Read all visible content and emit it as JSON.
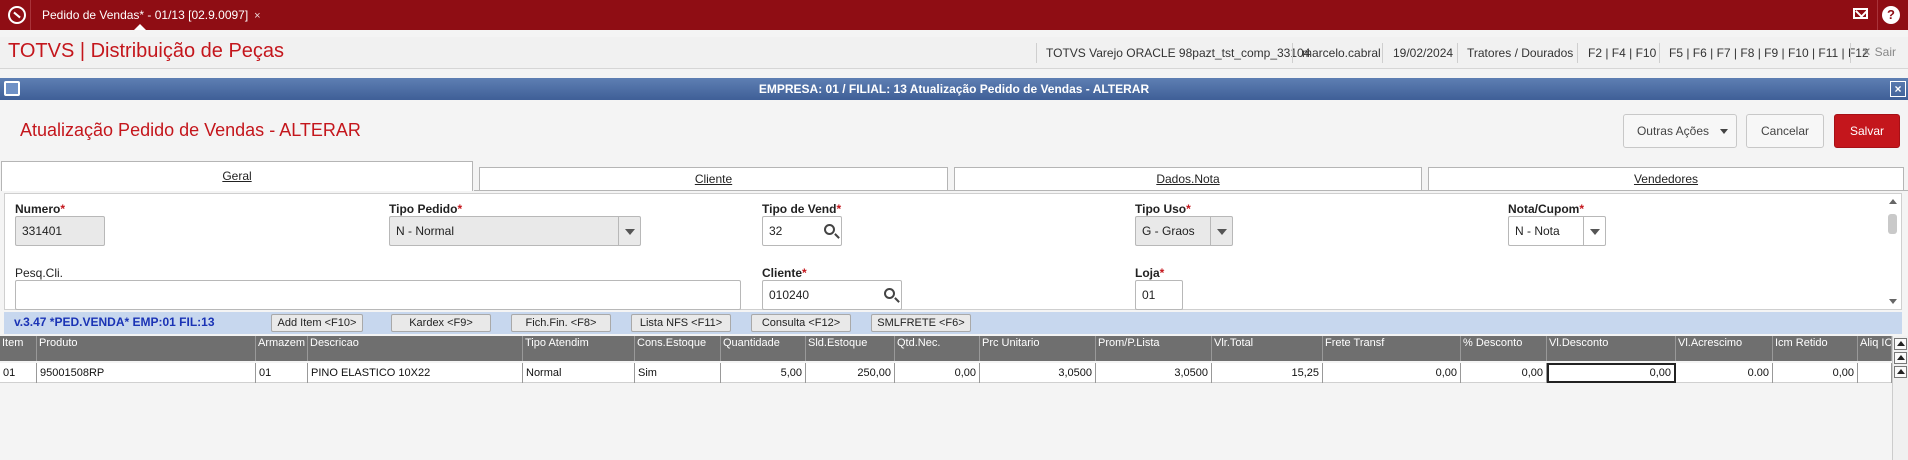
{
  "topbar": {
    "tab_label": "Pedido de Vendas* - 01/13 [02.9.0097]",
    "tab_close": "×",
    "help_label": "?"
  },
  "header": {
    "brand": "TOTVS | Distribuição de Peças",
    "env": "TOTVS Varejo ORACLE 98pazt_tst_comp_33104",
    "user": "marcelo.cabral",
    "date": "19/02/2024",
    "branch": "Tratores / Dourados",
    "keys1": "F2 | F4 | F10",
    "keys2": "F5 | F6 | F7 | F8 | F9 | F10 | F11 | F12",
    "exit_label": "✕  Sair"
  },
  "window": {
    "title": "EMPRESA: 01 / FILIAL: 13 Atualização Pedido de Vendas - ALTERAR",
    "close": "×"
  },
  "page": {
    "title": "Atualização Pedido de Vendas - ALTERAR",
    "actions": {
      "more": "Outras Ações",
      "cancel": "Cancelar",
      "save": "Salvar"
    }
  },
  "tabs": [
    "Geral",
    "Cliente",
    "Dados.Nota",
    "Vendedores"
  ],
  "form": {
    "numero": {
      "label": "Numero",
      "value": "331401"
    },
    "tipo_pedido": {
      "label": "Tipo Pedido",
      "value": "N - Normal"
    },
    "tipo_vend": {
      "label": "Tipo de Vend",
      "value": "32"
    },
    "tipo_uso": {
      "label": "Tipo Uso",
      "value": "G - Graos"
    },
    "nota_cupom": {
      "label": "Nota/Cupom",
      "value": "N - Nota"
    },
    "pesq_cli": {
      "label": "Pesq.Cli.",
      "value": ""
    },
    "cliente": {
      "label": "Cliente",
      "value": "010240"
    },
    "loja": {
      "label": "Loja",
      "value": "01"
    },
    "required_mark": "*"
  },
  "toolbar": {
    "version": "v.3.47  *PED.VENDA* EMP:01 FIL:13",
    "buttons": [
      "Add Item  <F10>",
      "Kardex    <F9>",
      "Fich.Fin.  <F8>",
      "Lista NFS <F11>",
      "Consulta  <F12>",
      "SMLFRETE <F6>"
    ]
  },
  "grid": {
    "columns": [
      "Item",
      "Produto",
      "Armazem",
      "Descricao",
      "Tipo Atendim",
      "Cons.Estoque",
      "Quantidade",
      "Sld.Estoque",
      "Qtd.Nec.",
      "Prc Unitario",
      "Prom/P.Lista",
      "Vlr.Total",
      "Frete Transf",
      "% Desconto",
      "Vl.Desconto",
      "Vl.Acrescimo",
      "Icm Retido",
      "Aliq ICMS"
    ],
    "rows": [
      [
        "01",
        "95001508RP",
        "01",
        "PINO ELASTICO 10X22",
        "Normal",
        "Sim",
        "5,00",
        "250,00",
        "0,00",
        "3,0500",
        "3,0500",
        "15,25",
        "0,00",
        "0,00",
        "0,00",
        "0.00",
        "0,00",
        ""
      ]
    ]
  }
}
